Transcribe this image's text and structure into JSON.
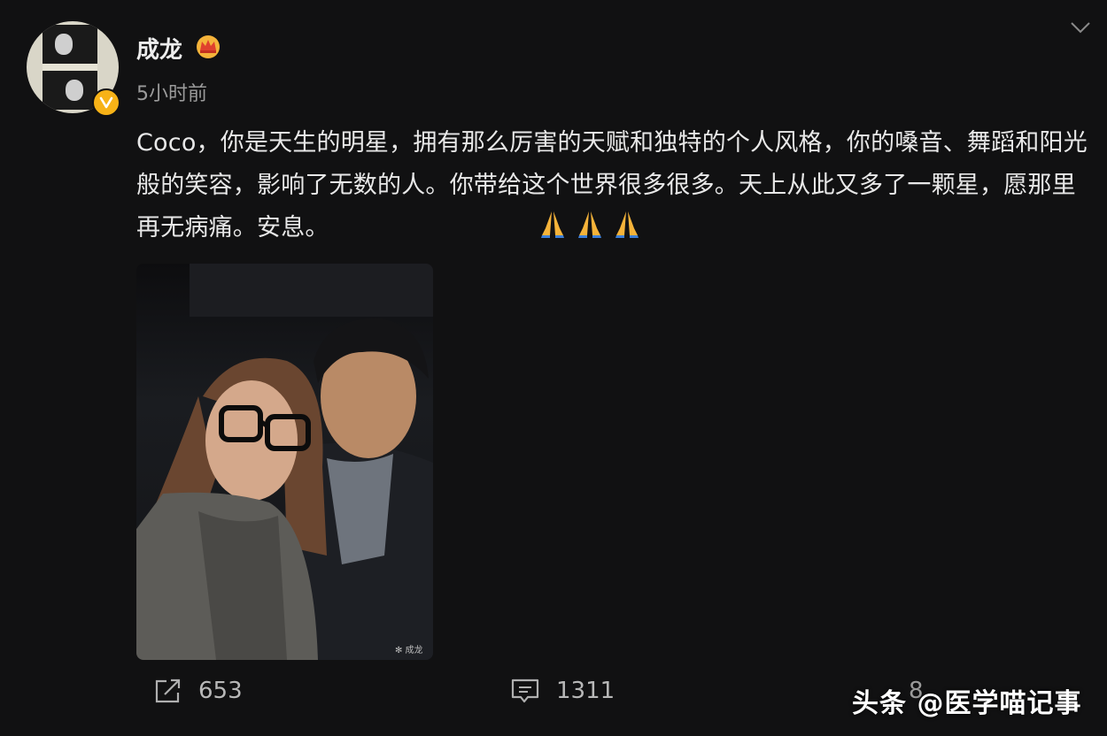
{
  "author": {
    "name": "成龙",
    "time": "5小时前"
  },
  "post": {
    "text": "Coco，你是天生的明星，拥有那么厉害的天赋和独特的个人风格，你的嗓音、舞蹈和阳光般的笑容，影响了无数的人。你带给这个世界很多很多。天上从此又多了一颗星，愿那里再无病痛。安息。",
    "emojis": [
      "pray-icon",
      "pray-icon",
      "pray-icon"
    ]
  },
  "actions": {
    "share_count": "653",
    "comment_count": "1311",
    "like_count": "8"
  },
  "watermark": "头条 @医学喵记事",
  "colors": {
    "background": "#111112",
    "badge": "#f7b217",
    "text": "#e8e8e8",
    "muted": "#9b9b9b"
  }
}
